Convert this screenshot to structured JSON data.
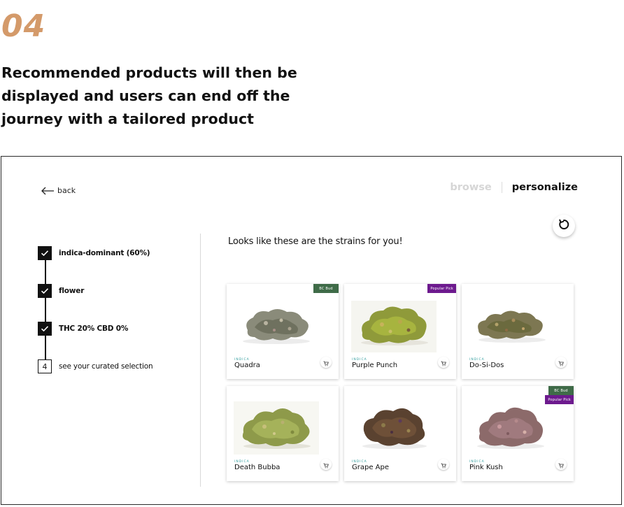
{
  "step_number": "04",
  "headline": "Recommended products will then be displayed and users can end off the journey with a tailored product",
  "nav": {
    "back_label": "back"
  },
  "mode_tabs": {
    "browse": "browse",
    "personalize": "personalize",
    "active": "personalize"
  },
  "quiz_steps": [
    {
      "label": "indica-dominant (60%)",
      "status": "done"
    },
    {
      "label": "flower",
      "status": "done"
    },
    {
      "label": "THC 20%  CBD 0%",
      "status": "done"
    },
    {
      "label": "see your curated selection",
      "status": "current",
      "number": "4"
    }
  ],
  "results": {
    "prompt": "Looks like these are the strains for you!",
    "products": [
      {
        "name": "Quadra",
        "type": "INDICA",
        "badges": [
          "BC Bud"
        ]
      },
      {
        "name": "Purple Punch",
        "type": "INDICA",
        "badges": [
          "Popular Pick"
        ]
      },
      {
        "name": "Do-Si-Dos",
        "type": "INDICA",
        "badges": []
      },
      {
        "name": "Death Bubba",
        "type": "INDICA",
        "badges": []
      },
      {
        "name": "Grape Ape",
        "type": "INDICA",
        "badges": []
      },
      {
        "name": "Pink Kush",
        "type": "INDICA",
        "badges": [
          "BC Bud",
          "Popular Pick"
        ]
      }
    ]
  },
  "icons": {
    "back": "arrow-left-icon",
    "reset": "refresh-icon",
    "checked_step": "checkmark-icon",
    "cart": "cart-icon"
  },
  "colors": {
    "accent_step_number": "#d49a6a",
    "badge_bc_bud": "#3f6b48",
    "badge_popular_pick": "#6d1a8e",
    "strain_type": "#2c9b9b",
    "inactive_tab": "#d6d6d6"
  }
}
